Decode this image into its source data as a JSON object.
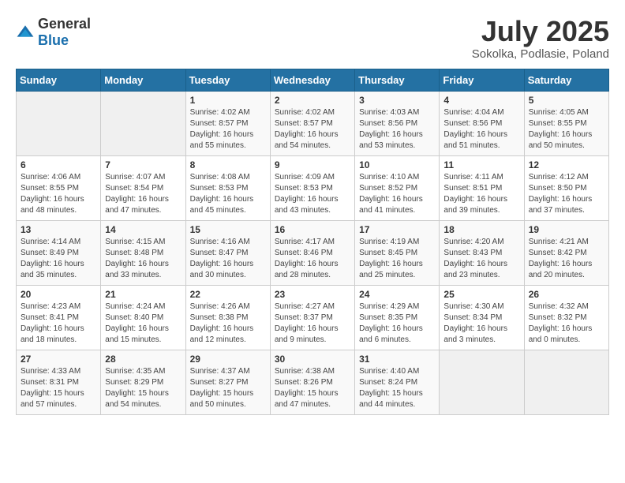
{
  "header": {
    "logo_general": "General",
    "logo_blue": "Blue",
    "month": "July 2025",
    "location": "Sokolka, Podlasie, Poland"
  },
  "days_of_week": [
    "Sunday",
    "Monday",
    "Tuesday",
    "Wednesday",
    "Thursday",
    "Friday",
    "Saturday"
  ],
  "weeks": [
    [
      {
        "day": "",
        "empty": true
      },
      {
        "day": "",
        "empty": true
      },
      {
        "day": "1",
        "sunrise": "4:02 AM",
        "sunset": "8:57 PM",
        "daylight": "16 hours and 55 minutes."
      },
      {
        "day": "2",
        "sunrise": "4:02 AM",
        "sunset": "8:57 PM",
        "daylight": "16 hours and 54 minutes."
      },
      {
        "day": "3",
        "sunrise": "4:03 AM",
        "sunset": "8:56 PM",
        "daylight": "16 hours and 53 minutes."
      },
      {
        "day": "4",
        "sunrise": "4:04 AM",
        "sunset": "8:56 PM",
        "daylight": "16 hours and 51 minutes."
      },
      {
        "day": "5",
        "sunrise": "4:05 AM",
        "sunset": "8:55 PM",
        "daylight": "16 hours and 50 minutes."
      }
    ],
    [
      {
        "day": "6",
        "sunrise": "4:06 AM",
        "sunset": "8:55 PM",
        "daylight": "16 hours and 48 minutes."
      },
      {
        "day": "7",
        "sunrise": "4:07 AM",
        "sunset": "8:54 PM",
        "daylight": "16 hours and 47 minutes."
      },
      {
        "day": "8",
        "sunrise": "4:08 AM",
        "sunset": "8:53 PM",
        "daylight": "16 hours and 45 minutes."
      },
      {
        "day": "9",
        "sunrise": "4:09 AM",
        "sunset": "8:53 PM",
        "daylight": "16 hours and 43 minutes."
      },
      {
        "day": "10",
        "sunrise": "4:10 AM",
        "sunset": "8:52 PM",
        "daylight": "16 hours and 41 minutes."
      },
      {
        "day": "11",
        "sunrise": "4:11 AM",
        "sunset": "8:51 PM",
        "daylight": "16 hours and 39 minutes."
      },
      {
        "day": "12",
        "sunrise": "4:12 AM",
        "sunset": "8:50 PM",
        "daylight": "16 hours and 37 minutes."
      }
    ],
    [
      {
        "day": "13",
        "sunrise": "4:14 AM",
        "sunset": "8:49 PM",
        "daylight": "16 hours and 35 minutes."
      },
      {
        "day": "14",
        "sunrise": "4:15 AM",
        "sunset": "8:48 PM",
        "daylight": "16 hours and 33 minutes."
      },
      {
        "day": "15",
        "sunrise": "4:16 AM",
        "sunset": "8:47 PM",
        "daylight": "16 hours and 30 minutes."
      },
      {
        "day": "16",
        "sunrise": "4:17 AM",
        "sunset": "8:46 PM",
        "daylight": "16 hours and 28 minutes."
      },
      {
        "day": "17",
        "sunrise": "4:19 AM",
        "sunset": "8:45 PM",
        "daylight": "16 hours and 25 minutes."
      },
      {
        "day": "18",
        "sunrise": "4:20 AM",
        "sunset": "8:43 PM",
        "daylight": "16 hours and 23 minutes."
      },
      {
        "day": "19",
        "sunrise": "4:21 AM",
        "sunset": "8:42 PM",
        "daylight": "16 hours and 20 minutes."
      }
    ],
    [
      {
        "day": "20",
        "sunrise": "4:23 AM",
        "sunset": "8:41 PM",
        "daylight": "16 hours and 18 minutes."
      },
      {
        "day": "21",
        "sunrise": "4:24 AM",
        "sunset": "8:40 PM",
        "daylight": "16 hours and 15 minutes."
      },
      {
        "day": "22",
        "sunrise": "4:26 AM",
        "sunset": "8:38 PM",
        "daylight": "16 hours and 12 minutes."
      },
      {
        "day": "23",
        "sunrise": "4:27 AM",
        "sunset": "8:37 PM",
        "daylight": "16 hours and 9 minutes."
      },
      {
        "day": "24",
        "sunrise": "4:29 AM",
        "sunset": "8:35 PM",
        "daylight": "16 hours and 6 minutes."
      },
      {
        "day": "25",
        "sunrise": "4:30 AM",
        "sunset": "8:34 PM",
        "daylight": "16 hours and 3 minutes."
      },
      {
        "day": "26",
        "sunrise": "4:32 AM",
        "sunset": "8:32 PM",
        "daylight": "16 hours and 0 minutes."
      }
    ],
    [
      {
        "day": "27",
        "sunrise": "4:33 AM",
        "sunset": "8:31 PM",
        "daylight": "15 hours and 57 minutes."
      },
      {
        "day": "28",
        "sunrise": "4:35 AM",
        "sunset": "8:29 PM",
        "daylight": "15 hours and 54 minutes."
      },
      {
        "day": "29",
        "sunrise": "4:37 AM",
        "sunset": "8:27 PM",
        "daylight": "15 hours and 50 minutes."
      },
      {
        "day": "30",
        "sunrise": "4:38 AM",
        "sunset": "8:26 PM",
        "daylight": "15 hours and 47 minutes."
      },
      {
        "day": "31",
        "sunrise": "4:40 AM",
        "sunset": "8:24 PM",
        "daylight": "15 hours and 44 minutes."
      },
      {
        "day": "",
        "empty": true
      },
      {
        "day": "",
        "empty": true
      }
    ]
  ]
}
